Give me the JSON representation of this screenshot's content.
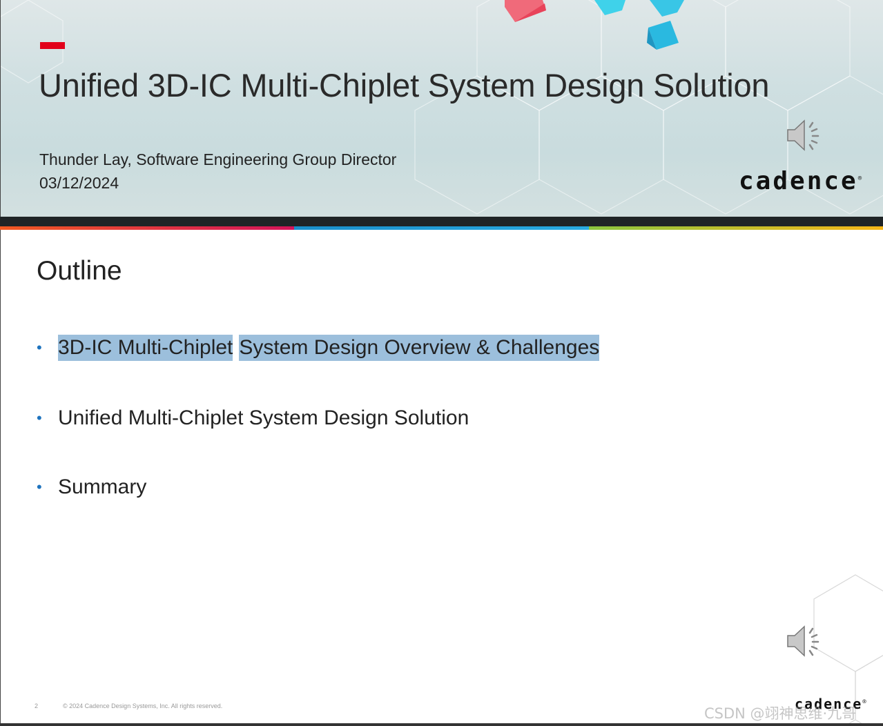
{
  "slide1": {
    "title": "Unified 3D-IC Multi-Chiplet System Design Solution",
    "presenter": "Thunder Lay, Software Engineering Group Director",
    "date": "03/12/2024",
    "logo_text": "cadence",
    "speaker_icon": "speaker-icon"
  },
  "colors": {
    "brand_red": "#e2001a",
    "bullet_blue": "#1e73be",
    "highlight": "#9cbfdc",
    "bar_segments": [
      "#e8441b",
      "#1a8fcb",
      "#f2b418"
    ]
  },
  "slide2": {
    "title": "Outline",
    "bullet_glyph": "•",
    "bullets": [
      {
        "part1": "3D-IC Multi-Chiplet",
        "part2": "System Design Overview & Challenges"
      },
      {
        "text": "Unified Multi-Chiplet System Design Solution"
      },
      {
        "text": "Summary"
      }
    ],
    "slide_number": "2",
    "copyright": "© 2024 Cadence Design Systems, Inc. All rights reserved.",
    "logo_text": "cadence",
    "speaker_icon": "speaker-icon"
  },
  "watermark": "CSDN @翊神思维·九哥"
}
